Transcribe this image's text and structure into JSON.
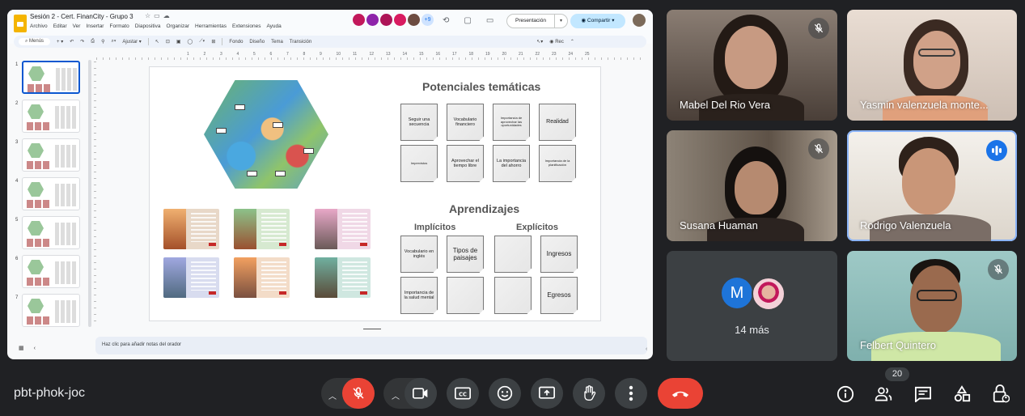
{
  "meeting": {
    "code": "pbt-phok-joc",
    "participant_count": "20"
  },
  "slides_app": {
    "doc_title": "Sesión 2 - Cert. FinanCity - Grupo 3",
    "menus": [
      "Archivo",
      "Editar",
      "Ver",
      "Insertar",
      "Formato",
      "Diapositiva",
      "Organizar",
      "Herramientas",
      "Extensiones",
      "Ayuda"
    ],
    "present_label": "Presentación",
    "share_label": "Compartir",
    "toolbar": {
      "search_label": "Menús",
      "fit_label": "Ajustar",
      "background_label": "Fondo",
      "layout_label": "Diseño",
      "theme_label": "Tema",
      "transition_label": "Transición",
      "rec_label": "Rec"
    },
    "ruler_labels": [
      "1",
      "2",
      "3",
      "4",
      "5",
      "6",
      "7",
      "8",
      "9",
      "10",
      "11",
      "12",
      "13",
      "14",
      "15",
      "16",
      "17",
      "18",
      "19",
      "20",
      "21",
      "22",
      "23",
      "24",
      "25"
    ],
    "thumbnail_numbers": [
      "1",
      "2",
      "3",
      "4",
      "5",
      "6",
      "7"
    ],
    "speaker_notes_placeholder": "Haz clic para añadir notas del orador",
    "slide": {
      "title_potenciales": "Potenciales temáticas",
      "potenciales": [
        "Seguir una secuencia",
        "Vocabulario financiero",
        "Importancia de aprovechar las oportunidades",
        "Realidad",
        "Imprevistos",
        "Aprovechar el tiempo libre",
        "La importancia del ahorro",
        "Importancia de la planificación"
      ],
      "title_aprendizajes": "Aprendizajes",
      "implicitos_label": "Implícitos",
      "explicitos_label": "Explícitos",
      "implicitos": [
        "Vocabulario en inglés",
        "Tipos de paisajes",
        "Importancia de la salud mental",
        ""
      ],
      "explicitos": [
        "",
        "Ingresos",
        "",
        "Egresos"
      ]
    }
  },
  "participants": [
    {
      "name": "Mabel Del Rio Vera",
      "muted": true
    },
    {
      "name": "Yasmin valenzuela monte...",
      "muted": false
    },
    {
      "name": "Susana Huaman",
      "muted": true
    },
    {
      "name": "Rodrigo Valenzuela",
      "muted": false,
      "speaking": true
    },
    {
      "name": "Felbert Quintero",
      "muted": true
    }
  ],
  "others_tile": {
    "initial": "M",
    "label": "14 más"
  },
  "colors": {
    "accent_blue": "#1a73e8",
    "hangup_red": "#ea4335",
    "bg": "#202124"
  }
}
